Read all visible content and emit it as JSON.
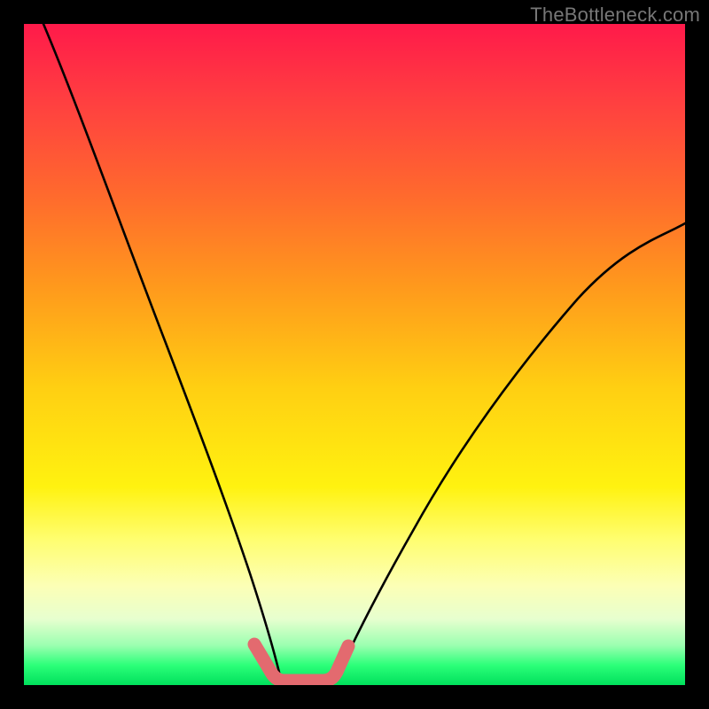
{
  "watermark": "TheBottleneck.com",
  "chart_data": {
    "type": "line",
    "title": "",
    "xlabel": "",
    "ylabel": "",
    "xlim": [
      0,
      100
    ],
    "ylim": [
      0,
      100
    ],
    "grid": false,
    "series": [
      {
        "name": "left-curve",
        "color": "#000000",
        "x": [
          3,
          6,
          10,
          14,
          18,
          22,
          25,
          28,
          30,
          32,
          34,
          36,
          37.5,
          38.5
        ],
        "y": [
          100,
          90,
          78,
          66,
          55,
          44,
          35,
          26,
          19,
          13,
          8,
          4,
          1.5,
          0.5
        ]
      },
      {
        "name": "right-curve",
        "color": "#000000",
        "x": [
          47,
          48,
          50,
          53,
          57,
          62,
          68,
          74,
          80,
          86,
          92,
          98,
          100
        ],
        "y": [
          0.5,
          2,
          5,
          10,
          17,
          25,
          33,
          41,
          48,
          55,
          61,
          67,
          70
        ]
      },
      {
        "name": "bottom-highlight",
        "color": "#e36a6f",
        "x": [
          35,
          37,
          38.5,
          40,
          42,
          45,
          47,
          48.5
        ],
        "y": [
          6,
          2,
          0.6,
          0.5,
          0.5,
          0.6,
          2,
          5
        ]
      }
    ],
    "background_gradient": {
      "top": "#ff1a4a",
      "mid1": "#ff9a1c",
      "mid2": "#fff210",
      "bottom": "#00e05c"
    }
  }
}
